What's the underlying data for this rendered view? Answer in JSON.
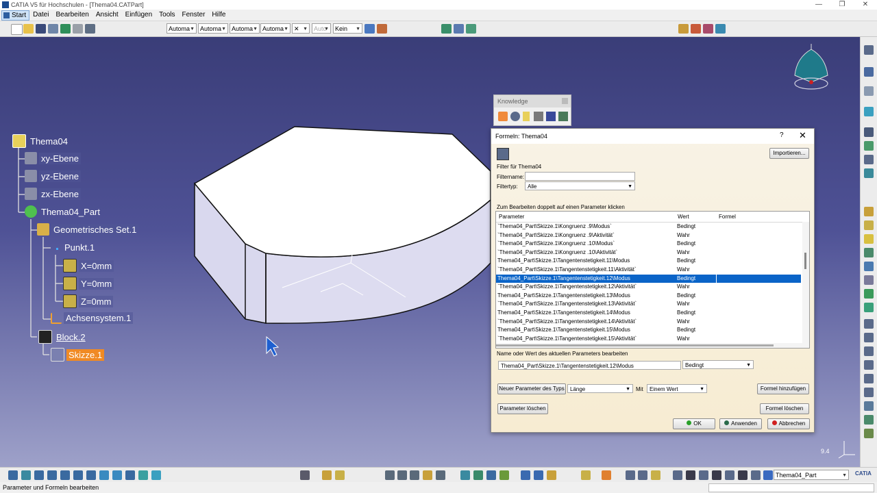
{
  "window": {
    "title": "CATIA V5 für Hochschulen - [Thema04.CATPart]",
    "controls": [
      "—",
      "❐",
      "✕"
    ]
  },
  "menu": {
    "items": [
      "Start",
      "Datei",
      "Bearbeiten",
      "Ansicht",
      "Einfügen",
      "Tools",
      "Fenster",
      "Hilfe"
    ]
  },
  "toolbar": {
    "combos": [
      "Automa",
      "Automa",
      "Automa",
      "Automa",
      "Auto",
      "Kein"
    ],
    "x_glyph": "✕"
  },
  "tree": {
    "nodes": [
      {
        "label": "Thema04",
        "icon": "product-icon"
      },
      {
        "label": "xy-Ebene",
        "icon": "plane-icon"
      },
      {
        "label": "yz-Ebene",
        "icon": "plane-icon"
      },
      {
        "label": "zx-Ebene",
        "icon": "plane-icon"
      },
      {
        "label": "Thema04_Part",
        "icon": "part-gear-icon"
      },
      {
        "label": "Geometrisches Set.1",
        "icon": "geometric-set-icon"
      },
      {
        "label": "Punkt.1",
        "icon": "point-icon"
      },
      {
        "label": "X=0mm",
        "icon": "parameter-icon"
      },
      {
        "label": "Y=0mm",
        "icon": "parameter-icon"
      },
      {
        "label": "Z=0mm",
        "icon": "parameter-icon"
      },
      {
        "label": "Achsensystem.1",
        "icon": "axis-system-icon"
      },
      {
        "label": "Block.2",
        "icon": "pad-icon"
      },
      {
        "label": "Skizze.1",
        "icon": "sketch-icon"
      }
    ]
  },
  "knowledge": {
    "title": "Knowledge"
  },
  "dialog": {
    "title": "Formeln: Thema04",
    "help": "?",
    "close": "✕",
    "import_button": "Importieren...",
    "filter_title": "Filter für Thema04",
    "filtername_label": "Filtername:",
    "filtername_value": "",
    "filtertyp_label": "Filtertyp:",
    "filtertyp_value": "Alle",
    "hint": "Zum Bearbeiten doppelt auf einen Parameter klicken",
    "columns": [
      "Parameter",
      "Wert",
      "Formel"
    ],
    "rows": [
      {
        "param": "`Thema04_Part\\Skizze.1\\Kongruenz .9\\Modus`",
        "value": "Bedingt"
      },
      {
        "param": "`Thema04_Part\\Skizze.1\\Kongruenz .9\\Aktivität`",
        "value": "Wahr"
      },
      {
        "param": "`Thema04_Part\\Skizze.1\\Kongruenz .10\\Modus`",
        "value": "Bedingt"
      },
      {
        "param": "`Thema04_Part\\Skizze.1\\Kongruenz .10\\Aktivität`",
        "value": "Wahr"
      },
      {
        "param": "Thema04_Part\\Skizze.1\\Tangentenstetigkeit.11\\Modus",
        "value": "Bedingt"
      },
      {
        "param": "`Thema04_Part\\Skizze.1\\Tangentenstetigkeit.11\\Aktivität`",
        "value": "Wahr"
      },
      {
        "param": "Thema04_Part\\Skizze.1\\Tangentenstetigkeit.12\\Modus",
        "value": "Bedingt"
      },
      {
        "param": "`Thema04_Part\\Skizze.1\\Tangentenstetigkeit.12\\Aktivität`",
        "value": "Wahr"
      },
      {
        "param": "Thema04_Part\\Skizze.1\\Tangentenstetigkeit.13\\Modus",
        "value": "Bedingt"
      },
      {
        "param": "`Thema04_Part\\Skizze.1\\Tangentenstetigkeit.13\\Aktivität`",
        "value": "Wahr"
      },
      {
        "param": "Thema04_Part\\Skizze.1\\Tangentenstetigkeit.14\\Modus",
        "value": "Bedingt"
      },
      {
        "param": "`Thema04_Part\\Skizze.1\\Tangentenstetigkeit.14\\Aktivität`",
        "value": "Wahr"
      },
      {
        "param": "Thema04_Part\\Skizze.1\\Tangentenstetigkeit.15\\Modus",
        "value": "Bedingt"
      },
      {
        "param": "`Thema04_Part\\Skizze.1\\Tangentenstetigkeit.15\\Aktivität`",
        "value": "Wahr"
      }
    ],
    "selected_row": 6,
    "edit_label": "Name oder Wert des aktuellen Parameters bearbeiten",
    "edit_name": "Thema04_Part\\Skizze.1\\Tangentenstetigkeit.12\\Modus",
    "edit_value": "Bedingt",
    "new_param_button": "Neuer Parameter des Typs",
    "type_value": "Länge",
    "mit_label": "Mit",
    "mit_value": "Einem Wert",
    "add_formula_button": "Formel hinzufügen",
    "delete_param_button": "Parameter löschen",
    "delete_formula_button": "Formel löschen",
    "ok_button": "OK",
    "apply_button": "Anwenden",
    "cancel_button": "Abbrechen"
  },
  "viewport": {
    "corner_value": "9.4"
  },
  "bottom": {
    "part_combo": "Thema04_Part",
    "logo": "CATIA"
  },
  "status": {
    "text": "Parameter und Formeln bearbeiten"
  },
  "colors": {
    "accent": "#0a64c8",
    "selection": "#f08a24",
    "bg_top": "#3a3d78"
  }
}
